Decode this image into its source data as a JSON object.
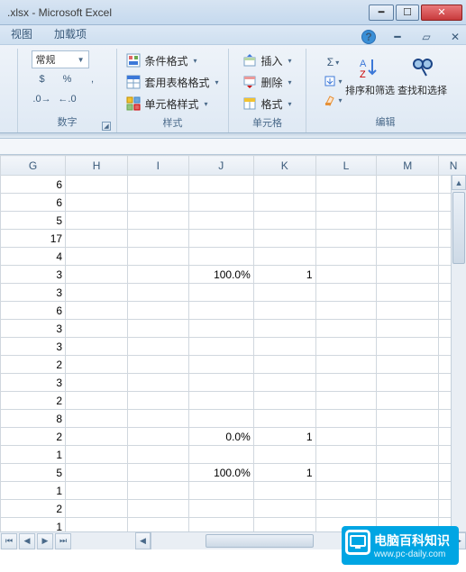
{
  "window": {
    "title": ".xlsx - Microsoft Excel"
  },
  "tabs": {
    "view": "视图",
    "addins": "加载项"
  },
  "ribbon": {
    "number": {
      "label": "数字",
      "format_combo": "常规"
    },
    "styles": {
      "label": "样式",
      "cond_format": "条件格式",
      "format_table": "套用表格格式",
      "cell_styles": "单元格样式"
    },
    "cells": {
      "label": "单元格",
      "insert": "插入",
      "delete": "删除",
      "format": "格式"
    },
    "editing": {
      "label": "编辑",
      "sort_filter": "排序和筛选",
      "find_select": "查找和选择"
    }
  },
  "columns": [
    "G",
    "H",
    "I",
    "J",
    "K",
    "L",
    "M",
    "N"
  ],
  "rows": [
    {
      "G": "6"
    },
    {
      "G": "6"
    },
    {
      "G": "5"
    },
    {
      "G": "17"
    },
    {
      "G": "4"
    },
    {
      "G": "3",
      "J": "100.0%",
      "K": "1"
    },
    {
      "G": "3"
    },
    {
      "G": "6"
    },
    {
      "G": "3"
    },
    {
      "G": "3"
    },
    {
      "G": "2"
    },
    {
      "G": "3"
    },
    {
      "G": "2"
    },
    {
      "G": "8"
    },
    {
      "G": "2",
      "J": "0.0%",
      "K": "1"
    },
    {
      "G": "1"
    },
    {
      "G": "5",
      "J": "100.0%",
      "K": "1"
    },
    {
      "G": "1"
    },
    {
      "G": "2"
    },
    {
      "G": "1"
    }
  ],
  "watermark": {
    "title": "电脑百科知识",
    "url": "www.pc-daily.com"
  }
}
